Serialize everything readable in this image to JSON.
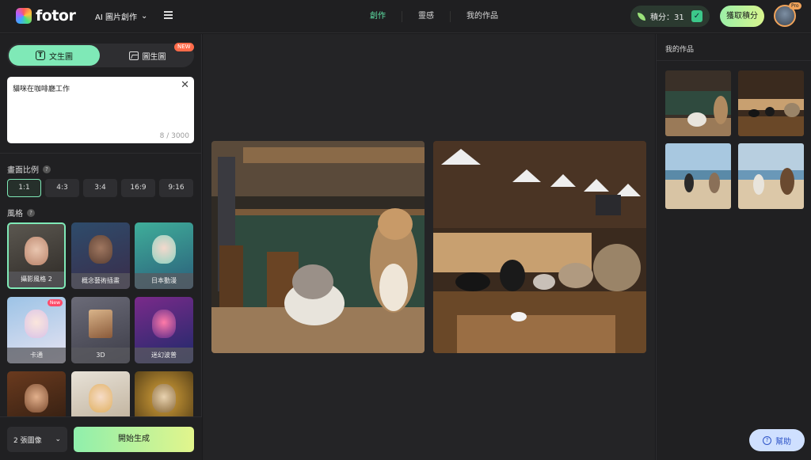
{
  "app": {
    "logo_text": "fotor"
  },
  "header": {
    "ai_menu_label": "AI 圖片創作",
    "nav": [
      {
        "label": "創作",
        "active": true
      },
      {
        "label": "靈感",
        "active": false
      },
      {
        "label": "我的作品",
        "active": false
      }
    ],
    "credits_label": "積分：31",
    "get_credits_label": "獲取積分",
    "pro_badge": "Pro"
  },
  "left_panel": {
    "tabs": {
      "text_to_image": "文生圖",
      "image_to_image": "圖生圖",
      "new_badge": "NEW"
    },
    "prompt": {
      "value": "貓咪在咖啡廳工作",
      "count": "8 / 3000"
    },
    "aspect_ratio": {
      "label": "畫面比例",
      "options": [
        "1:1",
        "4:3",
        "3:4",
        "16:9",
        "9:16"
      ],
      "selected": "1:1"
    },
    "style": {
      "label": "風格",
      "items": [
        {
          "label": "攝影風格 2",
          "active": true,
          "new": false
        },
        {
          "label": "概念藝術插畫",
          "active": false,
          "new": false
        },
        {
          "label": "日本動漫",
          "active": false,
          "new": false
        },
        {
          "label": "卡通",
          "active": false,
          "new": true,
          "new_label": "New"
        },
        {
          "label": "3D",
          "active": false,
          "new": false
        },
        {
          "label": "迷幻波普",
          "active": false,
          "new": false
        },
        {
          "label": "",
          "active": false,
          "new": false
        },
        {
          "label": "",
          "active": false,
          "new": false
        },
        {
          "label": "",
          "active": false,
          "new": false
        }
      ]
    },
    "image_count": "2 張圖像",
    "generate_label": "開始生成"
  },
  "right_panel": {
    "title": "我的作品"
  },
  "help_label": "幫助",
  "colors": {
    "accent": "#7fe9b7",
    "nav_active": "#5fe3a6",
    "background": "#1b1b1d"
  }
}
